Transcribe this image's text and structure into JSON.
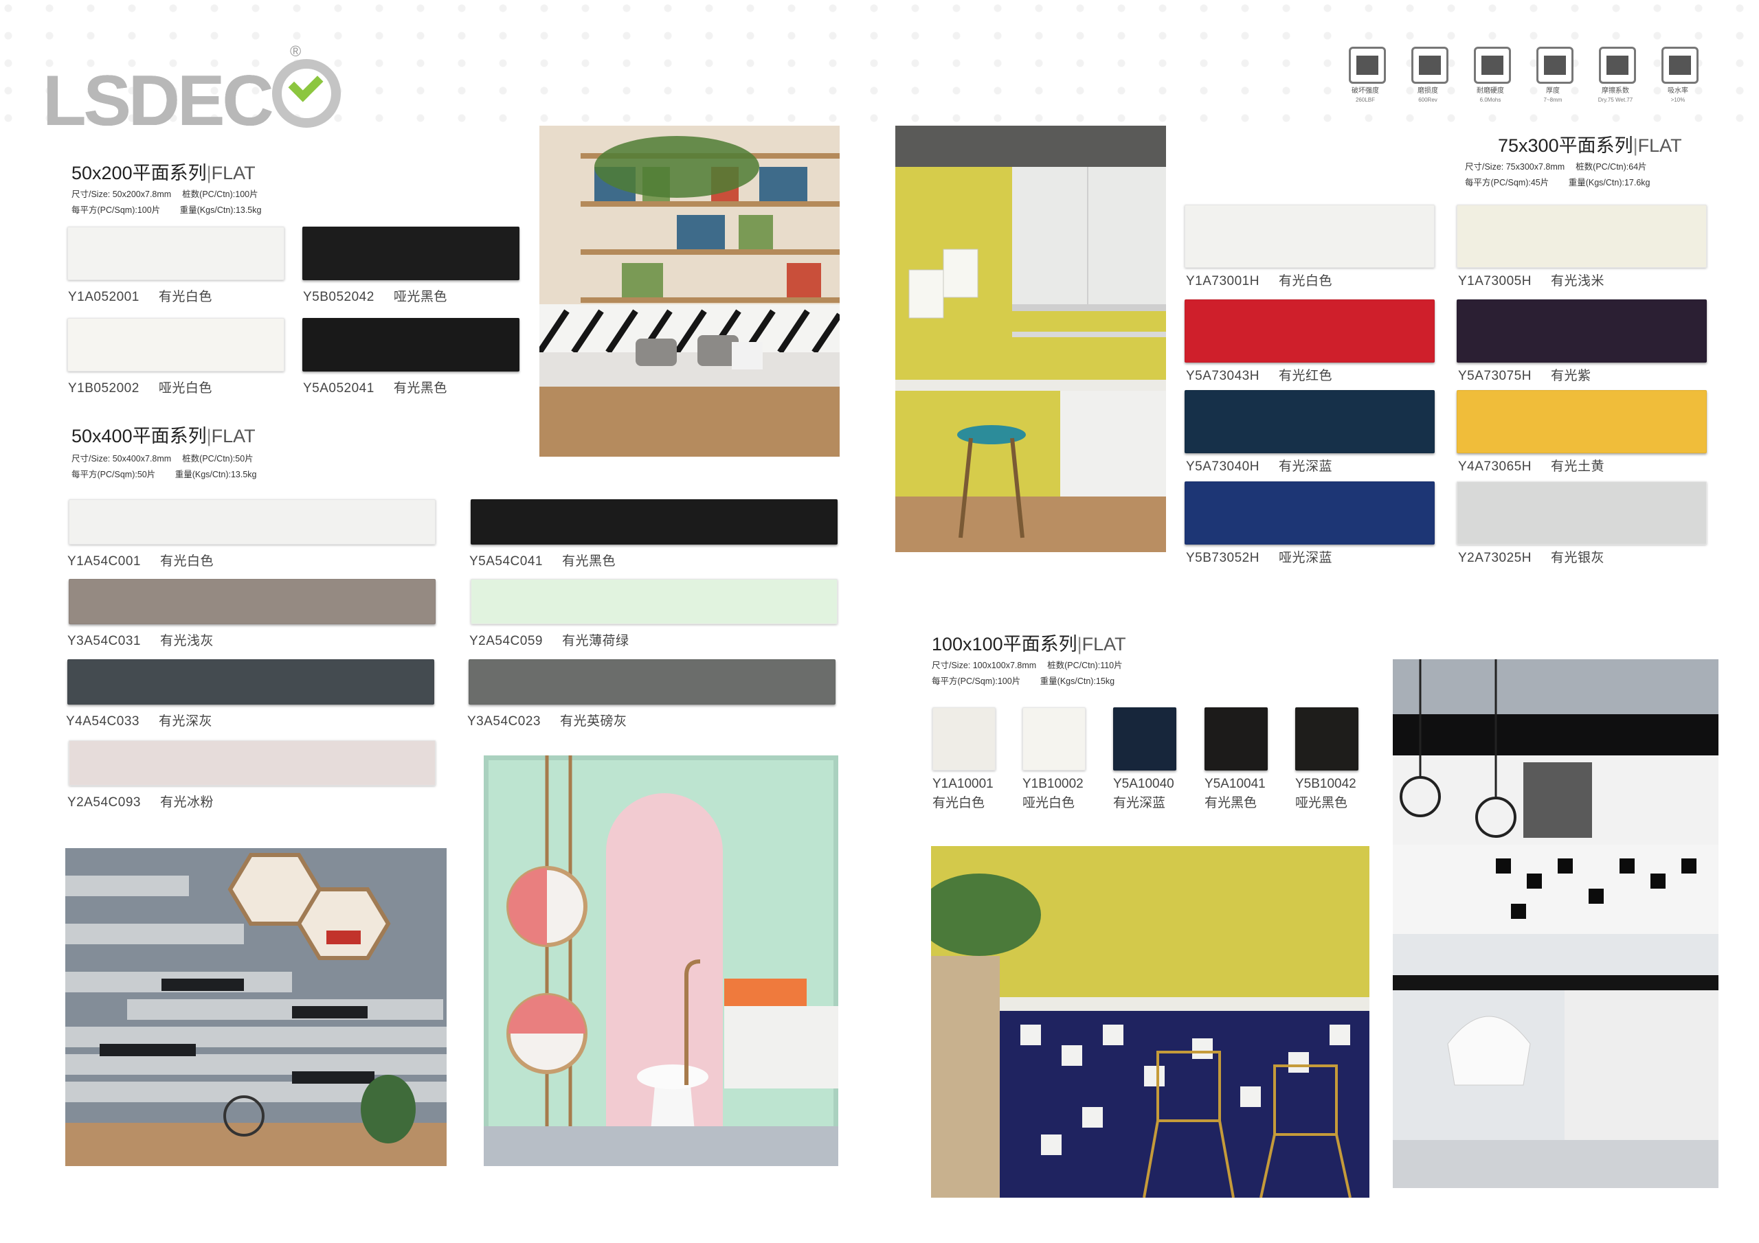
{
  "brand": {
    "name": "LSDECO",
    "registered": "®"
  },
  "icons": [
    {
      "icon": "breaking-strength-icon",
      "label": "破坏强度",
      "value": "260LBF"
    },
    {
      "icon": "abrasion-icon",
      "label": "磨损度",
      "value": "600Rev"
    },
    {
      "icon": "hardness-icon",
      "label": "耐磨硬度",
      "value": "6.0Mohs"
    },
    {
      "icon": "thickness-icon",
      "label": "厚度",
      "value": "7~8mm"
    },
    {
      "icon": "friction-icon",
      "label": "摩擦系数",
      "value": "Dry.75 Wet.77"
    },
    {
      "icon": "water-absorption-icon",
      "label": "吸水率",
      "value": ">10%"
    }
  ],
  "series_50x200": {
    "title": "50x200平面系列",
    "flat": "FLAT",
    "spec1": "尺寸/Size: 50x200x7.8mm  　桩数(PC/Ctn):100片",
    "spec2": "每平方(PC/Sqm):100片  　　重量(Kgs/Ctn):13.5kg",
    "tiles": [
      {
        "code": "Y1A052001",
        "name": "有光白色",
        "color": "#f3f3f1"
      },
      {
        "code": "Y5B052042",
        "name": "哑光黑色",
        "color": "#1c1c1c"
      },
      {
        "code": "Y1B052002",
        "name": "哑光白色",
        "color": "#f6f5f1"
      },
      {
        "code": "Y5A052041",
        "name": "有光黑色",
        "color": "#191919"
      }
    ]
  },
  "series_50x400": {
    "title": "50x400平面系列",
    "flat": "FLAT",
    "spec1": "尺寸/Size: 50x400x7.8mm  　桩数(PC/Ctn):50片",
    "spec2": "每平方(PC/Sqm):50片  　　重量(Kgs/Ctn):13.5kg",
    "tiles": [
      {
        "code": "Y1A54C001",
        "name": "有光白色",
        "color": "#f2f2f0"
      },
      {
        "code": "Y5A54C041",
        "name": "有光黑色",
        "color": "#1b1b1b"
      },
      {
        "code": "Y3A54C031",
        "name": "有光浅灰",
        "color": "#958a82"
      },
      {
        "code": "Y2A54C059",
        "name": "有光薄荷绿",
        "color": "#e1f3df"
      },
      {
        "code": "Y4A54C033",
        "name": "有光深灰",
        "color": "#444b50"
      },
      {
        "code": "Y3A54C023",
        "name": "有光英磅灰",
        "color": "#6b6d6b"
      },
      {
        "code": "Y2A54C093",
        "name": "有光冰粉",
        "color": "#e6dcda"
      }
    ]
  },
  "series_75x300": {
    "title": "75x300平面系列",
    "flat": "FLAT",
    "spec1": "尺寸/Size: 75x300x7.8mm  　桩数(PC/Ctn):64片",
    "spec2": "每平方(PC/Sqm):45片  　　重量(Kgs/Ctn):17.6kg",
    "tiles": [
      {
        "code": "Y1A73001H",
        "name": "有光白色",
        "color": "#f2f2ef"
      },
      {
        "code": "Y1A73005H",
        "name": "有光浅米",
        "color": "#f1efe1"
      },
      {
        "code": "Y5A73043H",
        "name": "有光红色",
        "color": "#cf1f2b"
      },
      {
        "code": "Y5A73075H",
        "name": "有光紫",
        "color": "#2b1f33"
      },
      {
        "code": "Y5A73040H",
        "name": "有光深蓝",
        "color": "#163049"
      },
      {
        "code": "Y4A73065H",
        "name": "有光土黄",
        "color": "#f0bd3a"
      },
      {
        "code": "Y5B73052H",
        "name": "哑光深蓝",
        "color": "#1d3675"
      },
      {
        "code": "Y2A73025H",
        "name": "有光银灰",
        "color": "#d8d9d8"
      }
    ]
  },
  "series_100x100": {
    "title": "100x100平面系列",
    "flat": "FLAT",
    "spec1": "尺寸/Size: 100x100x7.8mm  　桩数(PC/Ctn):110片",
    "spec2": "每平方(PC/Sqm):100片  　　重量(Kgs/Ctn):15kg",
    "tiles": [
      {
        "code": "Y1A10001",
        "name": "有光白色",
        "color": "#efede7"
      },
      {
        "code": "Y1B10002",
        "name": "哑光白色",
        "color": "#f5f4ef"
      },
      {
        "code": "Y5A10040",
        "name": "有光深蓝",
        "color": "#17263b"
      },
      {
        "code": "Y5A10041",
        "name": "有光黑色",
        "color": "#1c1b1a"
      },
      {
        "code": "Y5B10042",
        "name": "哑光黑色",
        "color": "#1e1d1b"
      }
    ]
  },
  "photos": [
    {
      "icon": "cafe-bookshelf-photo"
    },
    {
      "icon": "yellow-kitchen-photo"
    },
    {
      "icon": "grey-wall-shelves-photo"
    },
    {
      "icon": "mint-pink-bathroom-photo"
    },
    {
      "icon": "navy-yellow-bar-photo"
    },
    {
      "icon": "black-white-kitchen-photo"
    }
  ]
}
